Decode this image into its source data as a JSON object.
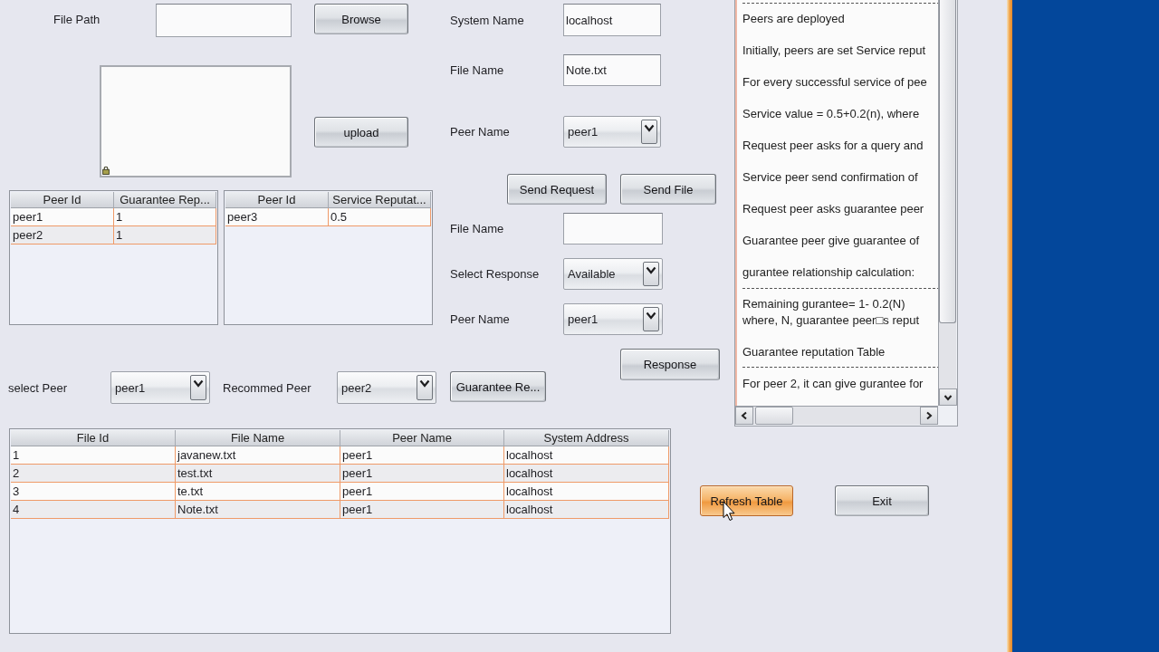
{
  "file_panel": {
    "file_path_label": "File Path",
    "browse_button": {
      "label": "Browse",
      "hovered": false
    },
    "upload_button": {
      "label": "upload",
      "hovered": false
    }
  },
  "guarantee_table": {
    "columns": [
      "Peer Id",
      "Guarantee Rep..."
    ],
    "rows": [
      [
        "peer1",
        "1"
      ],
      [
        "peer2",
        "1"
      ]
    ]
  },
  "service_table": {
    "columns": [
      "Peer Id",
      "Service Reputat..."
    ],
    "rows": [
      [
        "peer3",
        "0.5"
      ]
    ]
  },
  "request_form": {
    "fields": [
      {
        "kind": "text",
        "label": "System Name",
        "value": "localhost"
      },
      {
        "kind": "text",
        "label": "File Name",
        "value": "Note.txt"
      },
      {
        "kind": "dropdown",
        "label": "Peer Name",
        "value": "peer1"
      }
    ],
    "buttons": [
      {
        "label": "Send Request",
        "hovered": false
      },
      {
        "label": "Send File",
        "hovered": false
      }
    ]
  },
  "response_form": {
    "fields": [
      {
        "kind": "text",
        "label": "File Name"
      },
      {
        "kind": "dropdown",
        "label": "Select Response",
        "value": "Available"
      },
      {
        "kind": "dropdown",
        "label": "Peer Name",
        "value": "peer1"
      }
    ],
    "button": {
      "label": "Response",
      "hovered": false
    }
  },
  "guarantee_row": {
    "select_peer": {
      "label": "select Peer",
      "value": "peer1"
    },
    "recommend_peer": {
      "label": "Recommed Peer",
      "value": "peer2"
    },
    "button": {
      "label": "Guarantee Re...",
      "hovered": false
    }
  },
  "log_panel": {
    "paragraphs": [
      {
        "lines": [
          {
            "kind": "rule"
          },
          {
            "kind": "text",
            "text": "Peers are deployed"
          }
        ]
      },
      {
        "lines": [
          {
            "kind": "text",
            "text": "Initially, peers are set Service reput"
          }
        ]
      },
      {
        "lines": [
          {
            "kind": "text",
            "text": "For every successful service of pee"
          }
        ]
      },
      {
        "lines": [
          {
            "kind": "text",
            "text": "Service value = 0.5+0.2(n), where"
          }
        ]
      },
      {
        "lines": [
          {
            "kind": "text",
            "text": "Request peer asks for a query and"
          }
        ]
      },
      {
        "lines": [
          {
            "kind": "text",
            "text": "Service peer send confirmation of"
          }
        ]
      },
      {
        "lines": [
          {
            "kind": "text",
            "text": "Request peer asks guarantee peer"
          }
        ]
      },
      {
        "lines": [
          {
            "kind": "text",
            "text": "Guarantee peer give guarantee of"
          }
        ]
      },
      {
        "lines": [
          {
            "kind": "text",
            "text": "gurantee relationship calculation:"
          },
          {
            "kind": "rule"
          },
          {
            "kind": "text",
            "text": "Remaining gurantee= 1- 0.2(N)"
          },
          {
            "kind": "text",
            "text": "where, N, guarantee peer□s reput"
          }
        ]
      },
      {
        "lines": [
          {
            "kind": "text",
            "text": "Guarantee reputation Table"
          },
          {
            "kind": "rule"
          },
          {
            "kind": "text",
            "text": "For peer 2, it can give gurantee for"
          }
        ]
      }
    ]
  },
  "files_table": {
    "columns": [
      "File Id",
      "File Name",
      "Peer Name",
      "System Address"
    ],
    "rows": [
      [
        "1",
        "javanew.txt",
        "peer1",
        "localhost"
      ],
      [
        "2",
        "test.txt",
        "peer1",
        "localhost"
      ],
      [
        "3",
        "te.txt",
        "peer1",
        "localhost"
      ],
      [
        "4",
        "Note.txt",
        "peer1",
        "localhost"
      ]
    ]
  },
  "footer_buttons": [
    {
      "label": "Refresh Table",
      "hovered": true
    },
    {
      "label": "Exit",
      "hovered": false
    }
  ]
}
